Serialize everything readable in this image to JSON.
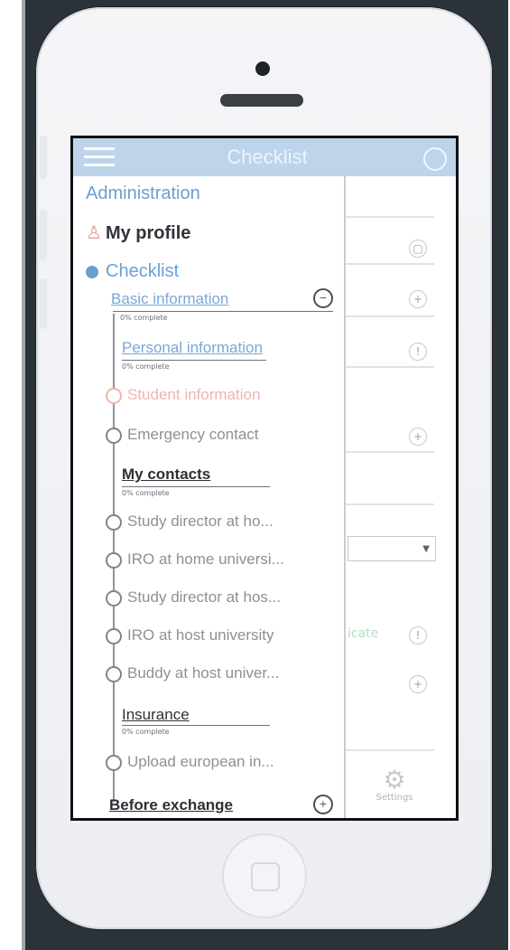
{
  "app": {
    "title": "Checklist"
  },
  "drawer": {
    "administration": "Administration",
    "my_profile": "My profile",
    "checklist": "Checklist",
    "sections": [
      {
        "label": "Basic information",
        "progress": "0% complete"
      },
      {
        "label": "Personal information",
        "progress": "0% complete"
      },
      {
        "label": "My contacts",
        "progress": "0% complete"
      },
      {
        "label": "Insurance",
        "progress": "0% complete"
      },
      {
        "label": "Before exchange"
      }
    ],
    "items": [
      "Student information",
      "Emergency contact",
      "Study director at ho...",
      "IRO at home universi...",
      "Study director at hos...",
      "IRO at host university",
      "Buddy at host univer...",
      "Upload european in..."
    ]
  },
  "background": {
    "settings_label": "Settings",
    "faint_text": "icate"
  },
  "colors": {
    "accent": "#6b9fd2",
    "topbar": "#bdd4ea",
    "warning": "#f0b4ad"
  }
}
